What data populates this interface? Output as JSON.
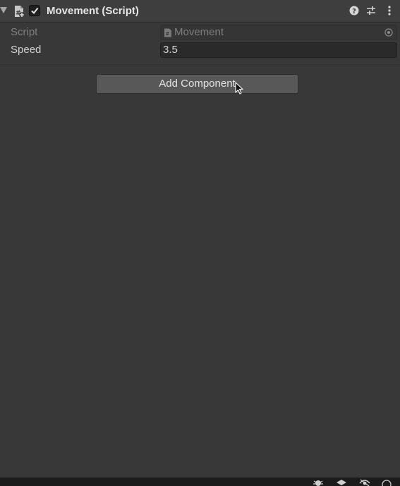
{
  "component": {
    "title": "Movement (Script)",
    "enabled": true,
    "icons": {
      "foldout": "foldout-arrow-icon",
      "script": "cs-script-icon",
      "help": "help-icon",
      "presets": "presets-icon",
      "menu": "kebab-menu-icon"
    }
  },
  "properties": {
    "script": {
      "label": "Script",
      "value": "Movement",
      "icon": "cs-script-icon",
      "picker_icon": "object-picker-icon"
    },
    "speed": {
      "label": "Speed",
      "value": "3.5"
    }
  },
  "add_component": {
    "label": "Add Component"
  },
  "status_bar": {
    "icons": [
      "debug-bug-icon",
      "layers-icon",
      "visibility-icon",
      "circle-icon"
    ]
  },
  "colors": {
    "panel_bg": "#383838",
    "header_bg": "#3e3e3e",
    "field_bg": "#2a2a2a",
    "button_bg": "#585858",
    "text": "#d2d2d2",
    "disabled_text": "#7f7f7f"
  }
}
